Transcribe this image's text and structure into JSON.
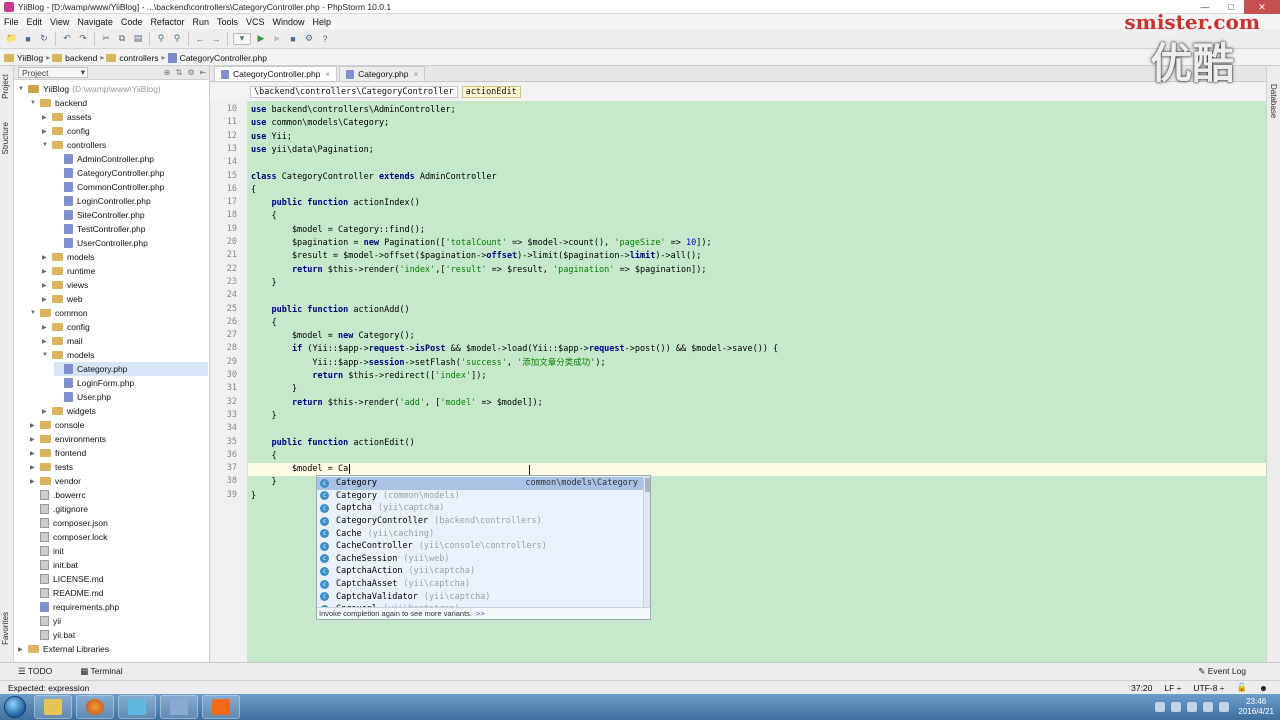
{
  "window": {
    "title": "YiiBlog - [D:/wamp/www/YiiBlog] - ...\\backend\\controllers\\CategoryController.php - PhpStorm 10.0.1"
  },
  "menu": [
    "File",
    "Edit",
    "View",
    "Navigate",
    "Code",
    "Refactor",
    "Run",
    "Tools",
    "VCS",
    "Window",
    "Help"
  ],
  "nav_crumbs": [
    "YiiBlog",
    "backend",
    "controllers",
    "CategoryController.php"
  ],
  "left_strip": {
    "project": "Project",
    "structure": "Structure",
    "favorites": "Favorites"
  },
  "right_strip": {
    "database": "Database"
  },
  "project_panel": {
    "selector": "Project"
  },
  "tree": [
    {
      "label": "YiiBlog",
      "dim": "(D:\\wamp\\www\\YiiBlog)",
      "level": 0,
      "kind": "folder-src",
      "open": true
    },
    {
      "label": "backend",
      "level": 1,
      "kind": "folder",
      "open": true
    },
    {
      "label": "assets",
      "level": 2,
      "kind": "folder",
      "open": false
    },
    {
      "label": "config",
      "level": 2,
      "kind": "folder",
      "open": false
    },
    {
      "label": "controllers",
      "level": 2,
      "kind": "folder",
      "open": true
    },
    {
      "label": "AdminController.php",
      "level": 3,
      "kind": "php"
    },
    {
      "label": "CategoryController.php",
      "level": 3,
      "kind": "php"
    },
    {
      "label": "CommonController.php",
      "level": 3,
      "kind": "php"
    },
    {
      "label": "LoginController.php",
      "level": 3,
      "kind": "php"
    },
    {
      "label": "SiteController.php",
      "level": 3,
      "kind": "php"
    },
    {
      "label": "TestController.php",
      "level": 3,
      "kind": "php"
    },
    {
      "label": "UserController.php",
      "level": 3,
      "kind": "php"
    },
    {
      "label": "models",
      "level": 2,
      "kind": "folder",
      "open": false
    },
    {
      "label": "runtime",
      "level": 2,
      "kind": "folder",
      "open": false
    },
    {
      "label": "views",
      "level": 2,
      "kind": "folder",
      "open": false
    },
    {
      "label": "web",
      "level": 2,
      "kind": "folder",
      "open": false
    },
    {
      "label": "common",
      "level": 1,
      "kind": "folder",
      "open": true
    },
    {
      "label": "config",
      "level": 2,
      "kind": "folder",
      "open": false
    },
    {
      "label": "mail",
      "level": 2,
      "kind": "folder",
      "open": false
    },
    {
      "label": "models",
      "level": 2,
      "kind": "folder",
      "open": true
    },
    {
      "label": "Category.php",
      "level": 3,
      "kind": "php",
      "selected": true
    },
    {
      "label": "LoginForm.php",
      "level": 3,
      "kind": "php"
    },
    {
      "label": "User.php",
      "level": 3,
      "kind": "php"
    },
    {
      "label": "widgets",
      "level": 2,
      "kind": "folder",
      "open": false
    },
    {
      "label": "console",
      "level": 1,
      "kind": "folder",
      "open": false
    },
    {
      "label": "environments",
      "level": 1,
      "kind": "folder",
      "open": false
    },
    {
      "label": "frontend",
      "level": 1,
      "kind": "folder",
      "open": false
    },
    {
      "label": "tests",
      "level": 1,
      "kind": "folder",
      "open": false
    },
    {
      "label": "vendor",
      "level": 1,
      "kind": "folder",
      "open": false
    },
    {
      "label": ".bowerrc",
      "level": 1,
      "kind": "file"
    },
    {
      "label": ".gitignore",
      "level": 1,
      "kind": "file"
    },
    {
      "label": "composer.json",
      "level": 1,
      "kind": "file"
    },
    {
      "label": "composer.lock",
      "level": 1,
      "kind": "file"
    },
    {
      "label": "init",
      "level": 1,
      "kind": "file"
    },
    {
      "label": "init.bat",
      "level": 1,
      "kind": "file"
    },
    {
      "label": "LICENSE.md",
      "level": 1,
      "kind": "file"
    },
    {
      "label": "README.md",
      "level": 1,
      "kind": "file"
    },
    {
      "label": "requirements.php",
      "level": 1,
      "kind": "php"
    },
    {
      "label": "yii",
      "level": 1,
      "kind": "file"
    },
    {
      "label": "yii.bat",
      "level": 1,
      "kind": "file"
    },
    {
      "label": "External Libraries",
      "level": 0,
      "kind": "lib",
      "open": false
    }
  ],
  "editor_tabs": [
    {
      "label": "CategoryController.php",
      "active": true
    },
    {
      "label": "Category.php",
      "active": false
    }
  ],
  "code_breadcrumb": [
    "\\backend\\controllers\\CategoryController",
    "actionEdit"
  ],
  "code": [
    {
      "n": 10,
      "html": "<span class=\"kw\">use</span> backend\\controllers\\AdminController;"
    },
    {
      "n": 11,
      "html": "<span class=\"kw\">use</span> common\\models\\Category;"
    },
    {
      "n": 12,
      "html": "<span class=\"kw\">use</span> Yii;"
    },
    {
      "n": 13,
      "html": "<span class=\"kw\">use</span> yii\\data\\Pagination;"
    },
    {
      "n": 14,
      "html": ""
    },
    {
      "n": 15,
      "html": "<span class=\"kw\">class</span> CategoryController <span class=\"kw\">extends</span> AdminController"
    },
    {
      "n": 16,
      "html": "{"
    },
    {
      "n": 17,
      "html": "    <span class=\"kw\">public function</span> actionIndex()"
    },
    {
      "n": 18,
      "html": "    {"
    },
    {
      "n": 19,
      "html": "        $model = Category::find();"
    },
    {
      "n": 20,
      "html": "        $pagination = <span class=\"kw\">new</span> Pagination([<span class=\"str\">'totalCount'</span> => $model->count(), <span class=\"str\">'pageSize'</span> => <span class=\"num\">10</span>]);"
    },
    {
      "n": 21,
      "html": "        $result = $model->offset($pagination-><span class=\"kw\">offset</span>)->limit($pagination-><span class=\"kw\">limit</span>)->all();"
    },
    {
      "n": 22,
      "html": "        <span class=\"kw\">return</span> $this->render(<span class=\"str\">'index'</span>,[<span class=\"str\">'result'</span> => $result, <span class=\"str\">'pagination'</span> => $pagination]);"
    },
    {
      "n": 23,
      "html": "    }"
    },
    {
      "n": 24,
      "html": ""
    },
    {
      "n": 25,
      "html": "    <span class=\"kw\">public function</span> actionAdd()"
    },
    {
      "n": 26,
      "html": "    {"
    },
    {
      "n": 27,
      "html": "        $model = <span class=\"kw\">new</span> Category();"
    },
    {
      "n": 28,
      "html": "        <span class=\"kw\">if</span> (Yii::$app-><span class=\"kw\">request</span>-><span class=\"kw\">isPost</span> && $model->load(Yii::$app-><span class=\"kw\">request</span>->post()) && $model->save()) {"
    },
    {
      "n": 29,
      "html": "            Yii::$app-><span class=\"kw\">session</span>->setFlash(<span class=\"str\">'success'</span>, <span class=\"str\">'添加文章分类成功'</span>);"
    },
    {
      "n": 30,
      "html": "            <span class=\"kw\">return</span> $this->redirect([<span class=\"str\">'index'</span>]);"
    },
    {
      "n": 31,
      "html": "        }"
    },
    {
      "n": 32,
      "html": "        <span class=\"kw\">return</span> $this->render(<span class=\"str\">'add'</span>, [<span class=\"str\">'model'</span> => $model]);"
    },
    {
      "n": 33,
      "html": "    }"
    },
    {
      "n": 34,
      "html": ""
    },
    {
      "n": 35,
      "html": "    <span class=\"kw\">public function</span> actionEdit()"
    },
    {
      "n": 36,
      "html": "    {"
    },
    {
      "n": 37,
      "html": "        $model = Ca",
      "current": true
    },
    {
      "n": 38,
      "html": "    }"
    },
    {
      "n": 39,
      "html": "}"
    }
  ],
  "completion": {
    "items": [
      {
        "name": "Category",
        "ns": "",
        "right": "common\\models\\Category",
        "selected": true
      },
      {
        "name": "Category",
        "ns": "(common\\models)",
        "right": ""
      },
      {
        "name": "Captcha",
        "ns": "(yii\\captcha)",
        "right": ""
      },
      {
        "name": "CategoryController",
        "ns": "(backend\\controllers)",
        "right": ""
      },
      {
        "name": "Cache",
        "ns": "(yii\\caching)",
        "right": ""
      },
      {
        "name": "CacheController",
        "ns": "(yii\\console\\controllers)",
        "right": ""
      },
      {
        "name": "CacheSession",
        "ns": "(yii\\web)",
        "right": ""
      },
      {
        "name": "CaptchaAction",
        "ns": "(yii\\captcha)",
        "right": ""
      },
      {
        "name": "CaptchaAsset",
        "ns": "(yii\\captcha)",
        "right": ""
      },
      {
        "name": "CaptchaValidator",
        "ns": "(yii\\captcha)",
        "right": ""
      },
      {
        "name": "Carousel",
        "ns": "(yii\\bootstrap)",
        "right": ""
      }
    ],
    "footer": "Invoke completion again to see more variants.",
    "footer_link": ">>"
  },
  "bottom_tabs": {
    "todo": "TODO",
    "terminal": "Terminal",
    "event_log": "Event Log"
  },
  "status": {
    "message": "Expected: expression",
    "position": "37:20",
    "line_sep": "LF ÷",
    "encoding": "UTF-8 ÷"
  },
  "taskbar": {
    "time": "23:46",
    "date": "2016/4/21"
  },
  "watermark": {
    "site": "smister.com",
    "brand": "优酷"
  }
}
